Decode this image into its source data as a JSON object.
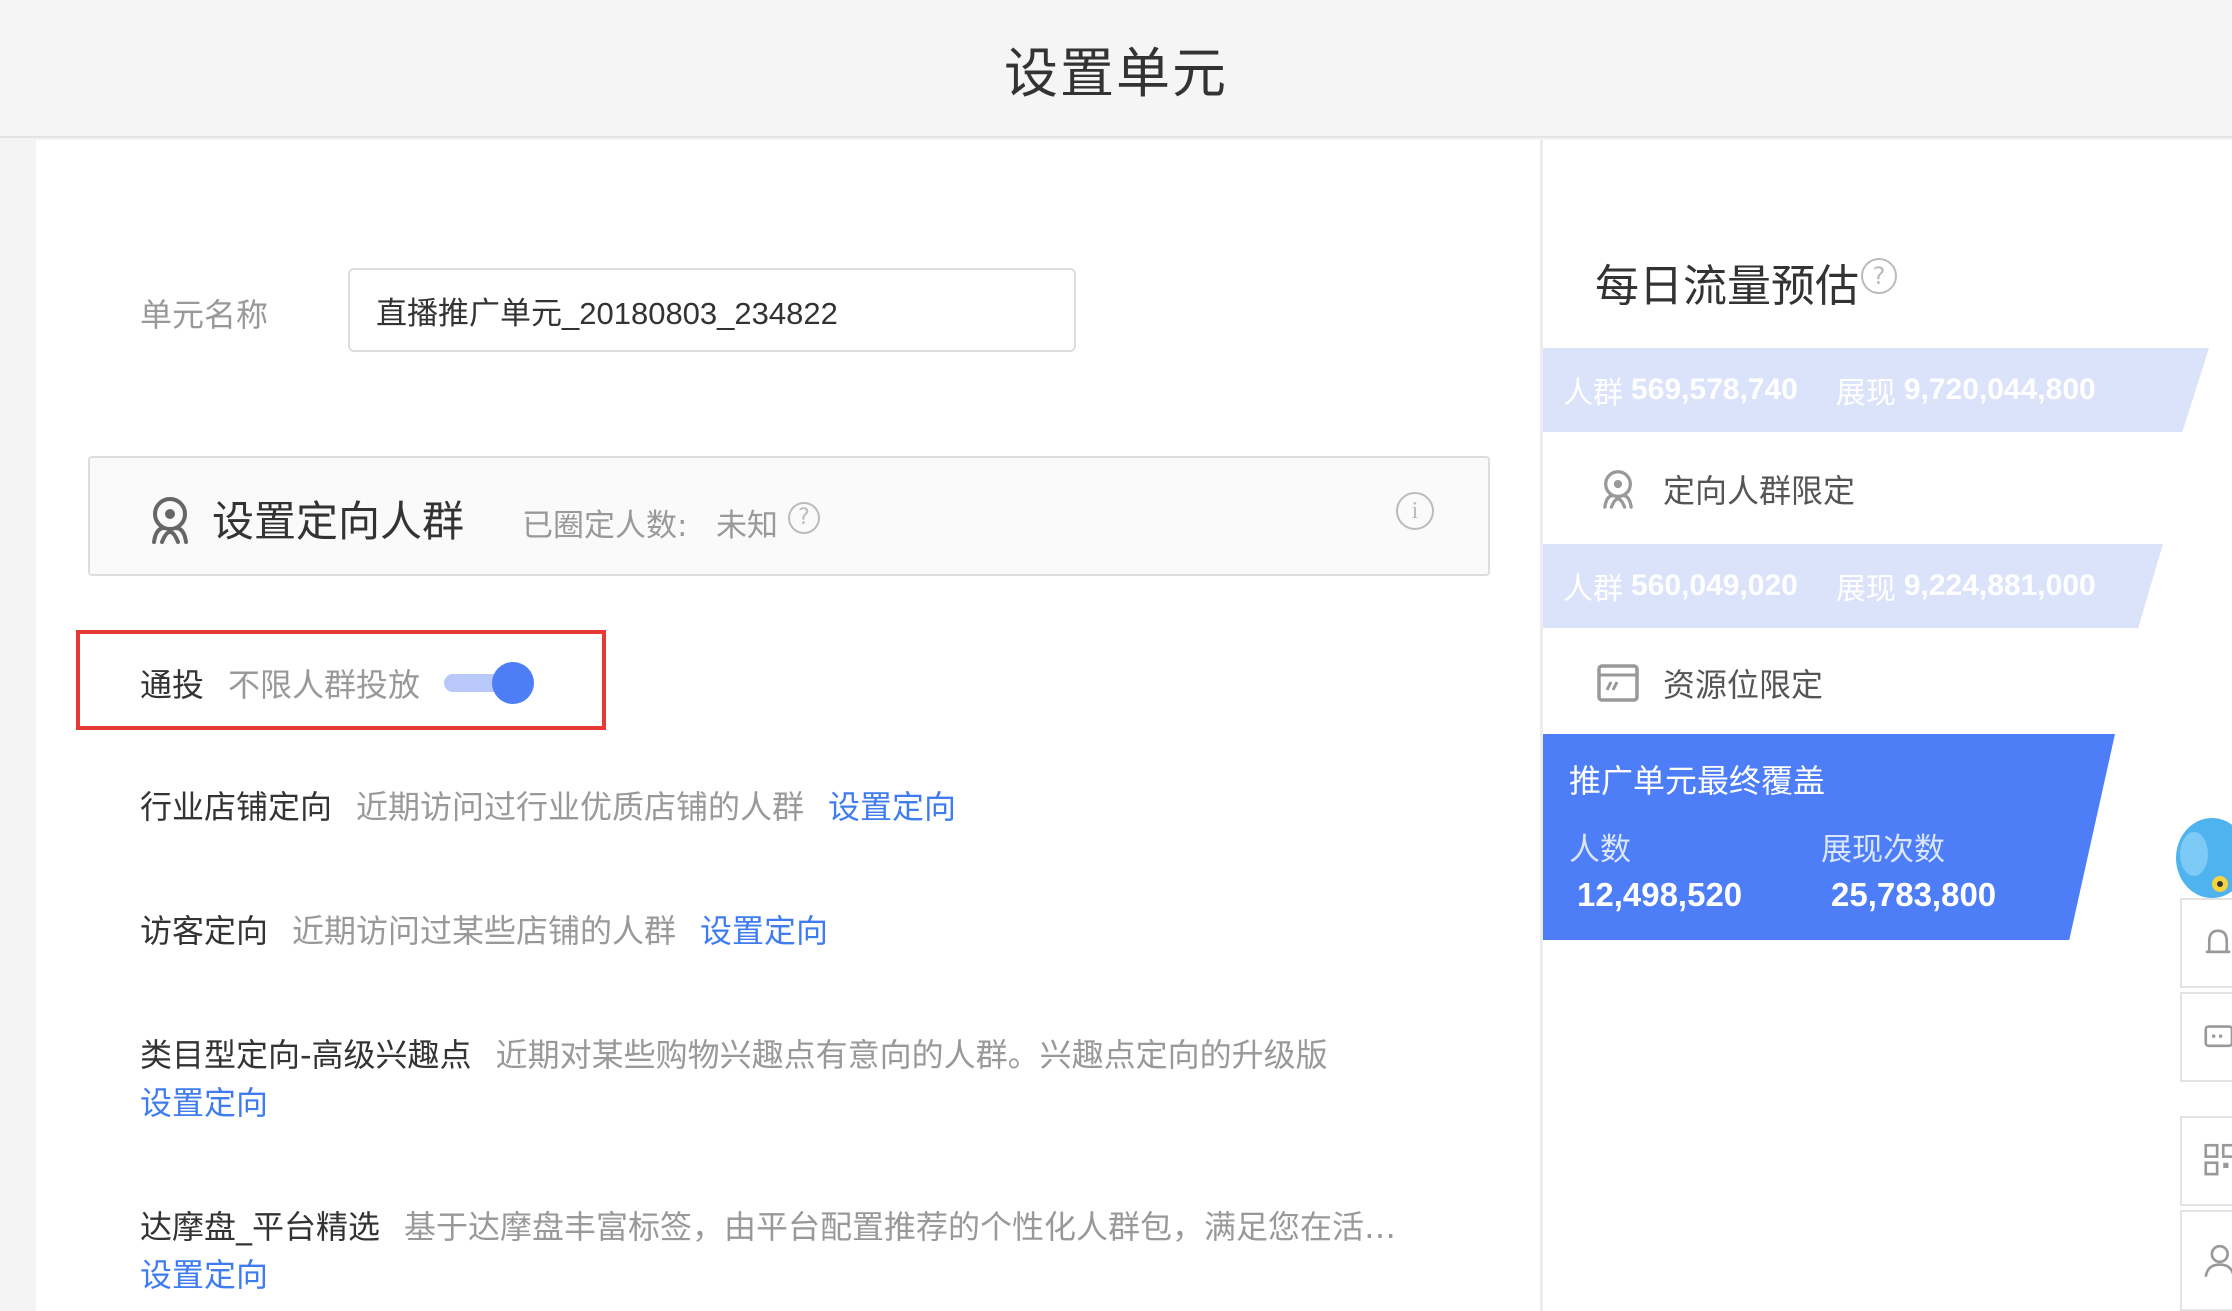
{
  "page": {
    "title": "设置单元"
  },
  "unit_name": {
    "label": "单元名称",
    "value": "直播推广单元_20180803_234822"
  },
  "targeting": {
    "title": "设置定向人群",
    "count_label": "已圈定人数:",
    "count_value": "未知",
    "help_glyph": "?",
    "info_glyph": "i"
  },
  "general_delivery": {
    "label": "通投",
    "description": "不限人群投放",
    "enabled": true
  },
  "options": [
    {
      "title": "行业店铺定向",
      "description": "近期访问过行业优质店铺的人群",
      "link": "设置定向"
    },
    {
      "title": "访客定向",
      "description": "近期访问过某些店铺的人群",
      "link": "设置定向"
    },
    {
      "title": "类目型定向-高级兴趣点",
      "description": "近期对某些购物兴趣点有意向的人群。兴趣点定向的升级版",
      "link": "设置定向"
    },
    {
      "title": "达摩盘_平台精选",
      "description": "基于达摩盘丰富标签，由平台配置推荐的个性化人群包，满足您在活…",
      "link": "设置定向"
    }
  ],
  "estimate": {
    "title": "每日流量预估",
    "help_glyph": "?",
    "band1": {
      "people_label": "人群",
      "people_value": "569,578,740",
      "impressions_label": "展现",
      "impressions_value": "9,720,044,800"
    },
    "step1_label": "定向人群限定",
    "band2": {
      "people_label": "人群",
      "people_value": "560,049,020",
      "impressions_label": "展现",
      "impressions_value": "9,224,881,000"
    },
    "step2_label": "资源位限定",
    "final": {
      "title": "推广单元最终覆盖",
      "people_label": "人数",
      "impressions_label": "展现次数",
      "people_value": "12,498,520",
      "impressions_value": "25,783,800"
    }
  },
  "colors": {
    "accent": "#4d7ef7",
    "link": "#3f7cf2",
    "highlight_border": "#e53935",
    "band": "#dbe3fb"
  },
  "side_tools": [
    "mascot-icon",
    "bell-icon",
    "chat-icon",
    "qrcode-icon",
    "user-icon"
  ]
}
